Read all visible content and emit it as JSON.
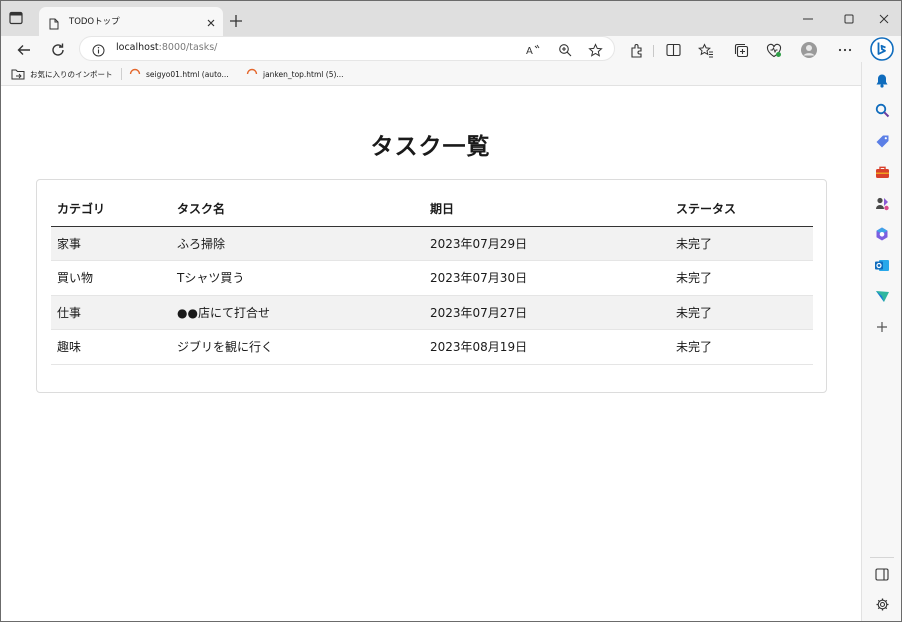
{
  "browser": {
    "tab_title": "TODOトップ",
    "url_host": "localhost",
    "url_rest": ":8000/tasks/",
    "bookmarks": [
      {
        "label": "お気に入りのインポート",
        "icon": "folder-import-icon"
      },
      {
        "label": "seigyo01.html (auto...",
        "icon": "loading-spinner-icon"
      },
      {
        "label": "janken_top.html (5)...",
        "icon": "loading-spinner-icon"
      }
    ],
    "accent_color": "#0f6cbd"
  },
  "page": {
    "heading": "タスク一覧",
    "table": {
      "columns": [
        "カテゴリ",
        "タスク名",
        "期日",
        "ステータス"
      ],
      "rows": [
        [
          "家事",
          "ふろ掃除",
          "2023年07月29日",
          "未完了"
        ],
        [
          "買い物",
          "Tシャツ買う",
          "2023年07月30日",
          "未完了"
        ],
        [
          "仕事",
          "●●店にて打合せ",
          "2023年07月27日",
          "未完了"
        ],
        [
          "趣味",
          "ジブリを観に行く",
          "2023年08月19日",
          "未完了"
        ]
      ]
    }
  }
}
